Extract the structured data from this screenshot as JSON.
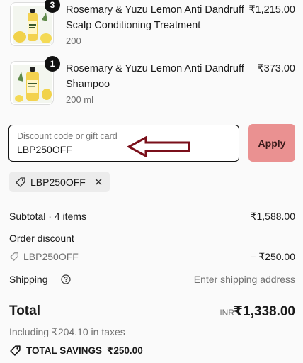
{
  "cart": {
    "items": [
      {
        "name": "Rosemary & Yuzu Lemon Anti Dandruff Scalp Conditioning Treatment",
        "variant": "200",
        "price": "₹1,215.00",
        "quantity": "3",
        "image_icon": "bottle-image"
      },
      {
        "name": "Rosemary & Yuzu Lemon Anti Dandruff Shampoo",
        "variant": "200 ml",
        "price": "₹373.00",
        "quantity": "1",
        "image_icon": "bottle-image"
      }
    ]
  },
  "discount": {
    "placeholder": "Discount code or gift card",
    "value": "LBP250OFF",
    "apply_label": "Apply",
    "applied_code": "LBP250OFF",
    "arrow_color": "#7a0f1a"
  },
  "summary": {
    "subtotal_label": "Subtotal · 4 items",
    "subtotal_value": "₹1,588.00",
    "order_discount_label": "Order discount",
    "discount_code": "LBP250OFF",
    "discount_value": "− ₹250.00",
    "shipping_label": "Shipping",
    "shipping_value": "Enter shipping address",
    "total_label": "Total",
    "currency": "INR",
    "total_value": "₹1,338.00",
    "taxes_text": "Including ₹204.10 in taxes",
    "savings_label": "TOTAL SAVINGS",
    "savings_value": "₹250.00"
  },
  "colors": {
    "apply_button": "#ea9191",
    "chip_bg": "#ececec"
  }
}
